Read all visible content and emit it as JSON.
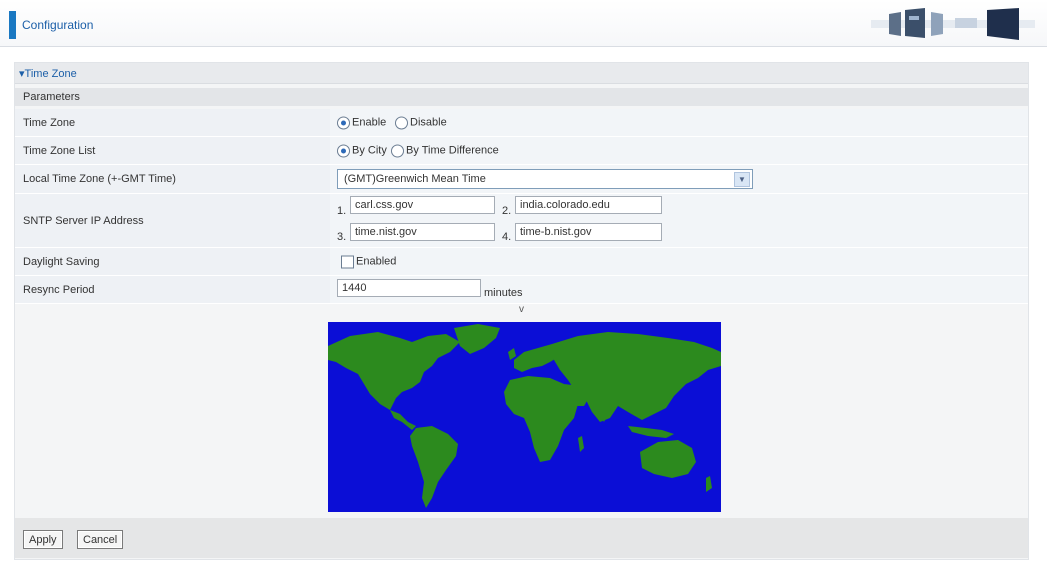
{
  "header": {
    "title": "Configuration",
    "accent_color": "#1a78c2"
  },
  "section": {
    "title": "Time Zone",
    "arrow": "▾"
  },
  "parameters": {
    "title": "Parameters",
    "time_zone": {
      "label": "Time Zone",
      "options": [
        "Enable",
        "Disable"
      ],
      "selected": "Enable"
    },
    "time_zone_list": {
      "label": "Time Zone List",
      "options": [
        "By City",
        "By Time Difference"
      ],
      "selected": "By City"
    },
    "local_time_zone": {
      "label": "Local Time Zone (+-GMT Time)",
      "value": "(GMT)Greenwich Mean Time"
    },
    "sntp": {
      "label": "SNTP Server IP Address",
      "servers": [
        {
          "num": "1.",
          "value": "carl.css.gov"
        },
        {
          "num": "2.",
          "value": "india.colorado.edu"
        },
        {
          "num": "3.",
          "value": "time.nist.gov"
        },
        {
          "num": "4.",
          "value": "time-b.nist.gov"
        }
      ]
    },
    "daylight_saving": {
      "label": "Daylight Saving",
      "checkbox_label": "Enabled",
      "checked": false
    },
    "resync_period": {
      "label": "Resync Period",
      "value": "1440",
      "unit": "minutes"
    }
  },
  "map": {
    "marker": "v",
    "ocean_color": "#0b0ed6",
    "land_color": "#2c8a1e"
  },
  "buttons": {
    "apply": "Apply",
    "cancel": "Cancel"
  }
}
